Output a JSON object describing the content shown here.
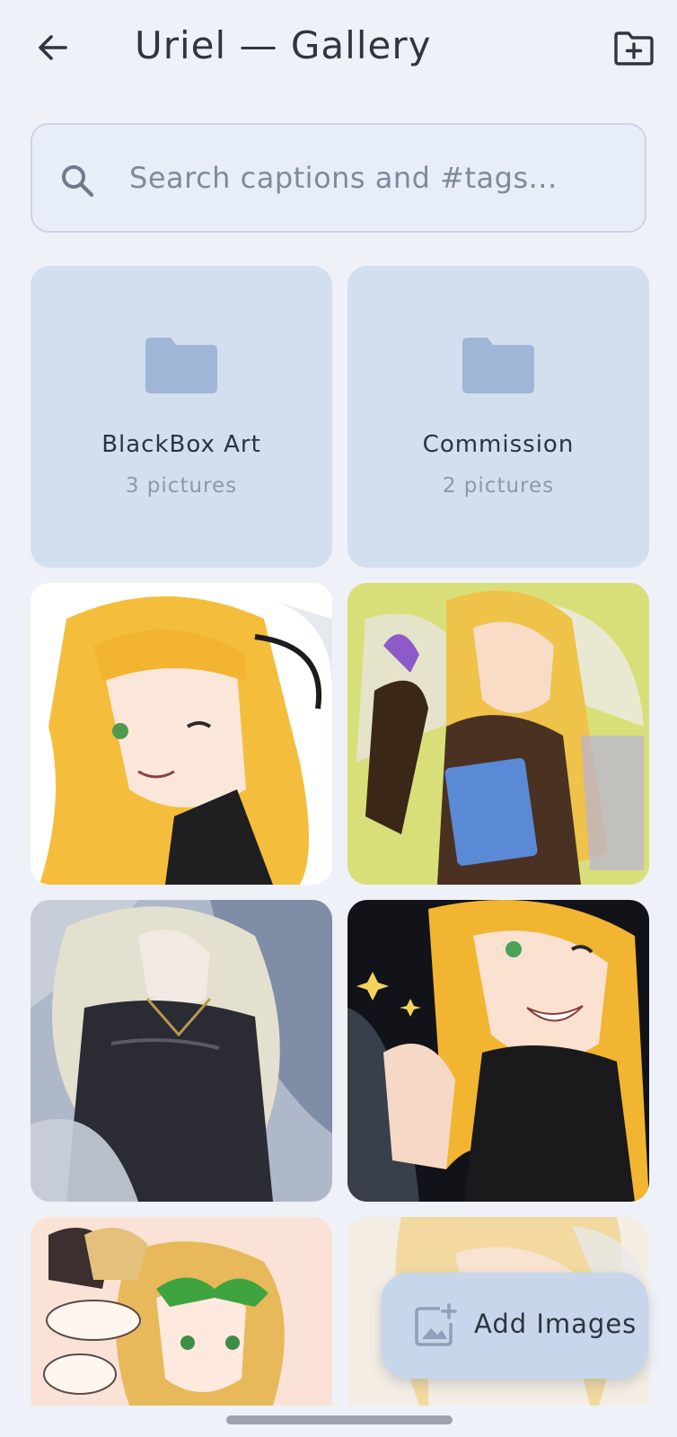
{
  "appbar": {
    "title": "Uriel — Gallery",
    "back_icon": "arrow-left-icon",
    "new_folder_icon": "folder-plus-icon"
  },
  "search": {
    "placeholder": "Search captions and #tags...",
    "icon": "search-icon"
  },
  "folders": [
    {
      "name": "BlackBox Art",
      "count": "3 pictures"
    },
    {
      "name": "Commission",
      "count": "2 pictures"
    }
  ],
  "images": [
    {
      "alt": "gallery-image-1"
    },
    {
      "alt": "gallery-image-2"
    },
    {
      "alt": "gallery-image-3"
    },
    {
      "alt": "gallery-image-4"
    },
    {
      "alt": "gallery-image-5"
    },
    {
      "alt": "gallery-image-6"
    }
  ],
  "fab": {
    "label": "Add Images",
    "icon": "add-photo-icon"
  },
  "colors": {
    "background": "#eef2f8",
    "folder_tile": "#d3deee",
    "folder_icon": "#9fb6d6",
    "fab": "#c7d6ea"
  }
}
